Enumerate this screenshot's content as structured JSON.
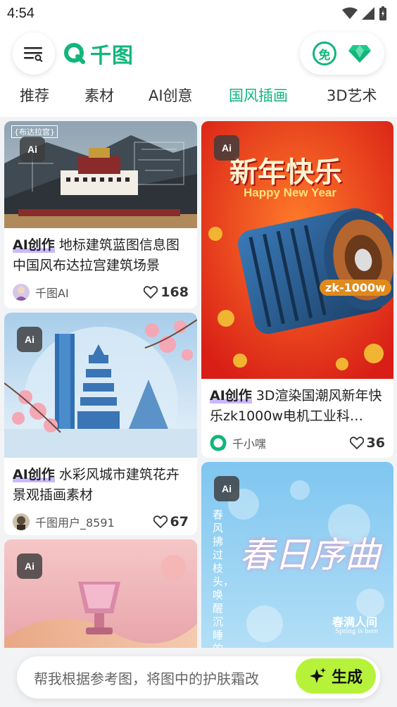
{
  "status_bar": {
    "time": "4:54"
  },
  "header": {
    "logo_text": "千图",
    "free_badge": "免",
    "icons": [
      "menu-search-icon",
      "vip-diamond-icon"
    ]
  },
  "tabs": [
    {
      "label": "推荐",
      "active": false
    },
    {
      "label": "素材",
      "active": false
    },
    {
      "label": "AI创意",
      "active": false
    },
    {
      "label": "国风插画",
      "active": true
    },
    {
      "label": "3D艺术",
      "active": false
    }
  ],
  "cards": [
    {
      "badge": "Ai",
      "ai_tag": "AI创作",
      "title": " 地标建筑蓝图信息图中国风布达拉宫建筑场景",
      "author": "千图AI",
      "likes": "168",
      "image_labels": [
        "{布达拉宫}"
      ]
    },
    {
      "badge": "Ai",
      "ai_tag": "AI创作",
      "title": " 3D渲染国潮风新年快乐zk1000w电机工业科…",
      "author": "千小嘿",
      "likes": "36",
      "image_labels": [
        "新年快乐",
        "Happy New Year",
        "zk-1000w"
      ]
    },
    {
      "badge": "Ai",
      "ai_tag": "AI创作",
      "title": " 水彩风城市建筑花卉景观插画素材",
      "author": "千图用户_8591",
      "likes": "67",
      "image_labels": []
    },
    {
      "badge": "Ai",
      "image_labels": [
        "春日序曲",
        "春风拂过枝头，唤醒沉睡的美好",
        "春满人间",
        "Spring is here"
      ]
    },
    {
      "badge": "Ai",
      "image_labels": []
    }
  ],
  "prompt": {
    "text": "帮我根据参考图，将图中的护肤霜改",
    "button_label": "生成"
  },
  "colors": {
    "brand_green": "#11b67a",
    "generate_button": "#b7f23a",
    "ai_highlight": "#c9b8ff"
  }
}
